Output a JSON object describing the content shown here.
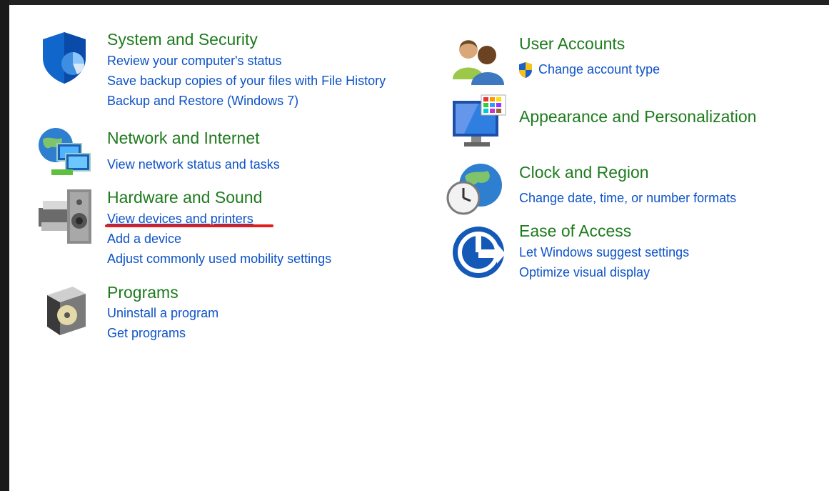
{
  "categories": {
    "system": {
      "title": "System and Security",
      "links": [
        "Review your computer's status",
        "Save backup copies of your files with File History",
        "Backup and Restore (Windows 7)"
      ]
    },
    "network": {
      "title": "Network and Internet",
      "links": [
        "View network status and tasks"
      ]
    },
    "hardware": {
      "title": "Hardware and Sound",
      "links": [
        "View devices and printers",
        "Add a device",
        "Adjust commonly used mobility settings"
      ]
    },
    "programs": {
      "title": "Programs",
      "links": [
        "Uninstall a program",
        "Get programs"
      ]
    },
    "users": {
      "title": "User Accounts",
      "links": [
        "Change account type"
      ]
    },
    "appearance": {
      "title": "Appearance and Personalization",
      "links": []
    },
    "clock": {
      "title": "Clock and Region",
      "links": [
        "Change date, time, or number formats"
      ]
    },
    "ease": {
      "title": "Ease of Access",
      "links": [
        "Let Windows suggest settings",
        "Optimize visual display"
      ]
    }
  },
  "colors": {
    "title_green": "#1e7b1e",
    "link_blue": "#0d52c8",
    "annotation_red": "#e31c1c"
  },
  "icons": {
    "system": "shield-icon",
    "network": "network-globe-icon",
    "hardware": "printer-speaker-icon",
    "programs": "software-box-icon",
    "users": "user-accounts-icon",
    "appearance": "monitor-palette-icon",
    "clock": "globe-clock-icon",
    "ease": "ease-of-access-icon",
    "uac": "uac-shield-icon"
  }
}
